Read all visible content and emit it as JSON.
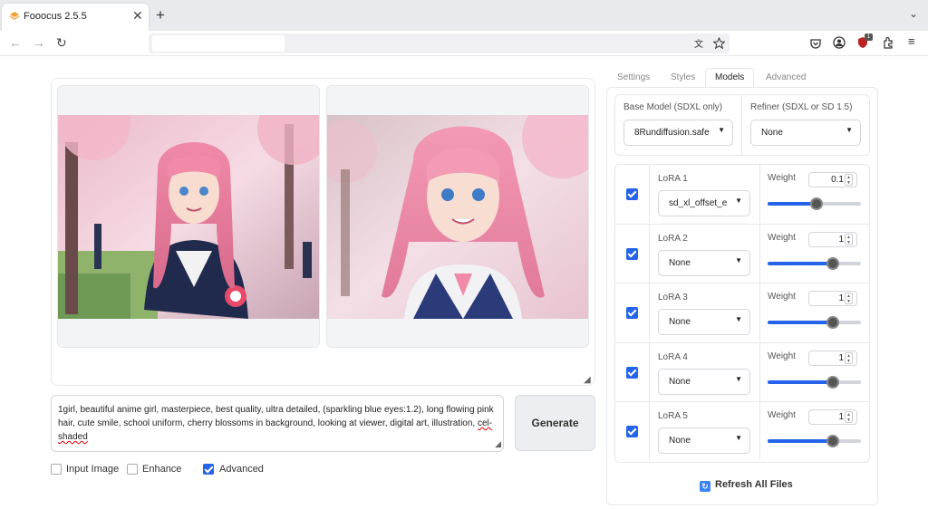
{
  "browser": {
    "tab_title": "Fooocus 2.5.5",
    "tab_close": "✕",
    "new_tab": "+",
    "tab_menu": "⌄",
    "extension_badge": "1",
    "colors": {
      "tab_strip": "#e8eaed",
      "url_bg": "#f0f0f4"
    }
  },
  "gallery": {
    "images": [
      {
        "alt": "Pink-haired anime girl in school uniform under cherry blossoms"
      },
      {
        "alt": "Pink-haired anime girl with twin tails smiling under cherry blossoms"
      }
    ]
  },
  "prompt": {
    "text_main": "1girl, beautiful anime girl, masterpiece, best quality, ultra detailed, (sparkling blue eyes:1.2), long flowing pink hair, cute smile, school uniform, cherry blossoms in background, looking at viewer, digital art, illustration, ",
    "text_marked": "cel-shaded"
  },
  "generate_label": "Generate",
  "options": {
    "input_image": {
      "label": "Input Image",
      "checked": false
    },
    "enhance": {
      "label": "Enhance",
      "checked": false
    },
    "advanced": {
      "label": "Advanced",
      "checked": true
    }
  },
  "panel_tabs": [
    "Settings",
    "Styles",
    "Models",
    "Advanced"
  ],
  "active_tab": "Models",
  "models": {
    "base_label": "Base Model (SDXL only)",
    "base_value": "8Rundiffusion.safe",
    "refiner_label": "Refiner (SDXL or SD 1.5)",
    "refiner_value": "None"
  },
  "loras": [
    {
      "label": "LoRA 1",
      "value": "sd_xl_offset_e",
      "weight_label": "Weight",
      "weight": "0.1",
      "slider_fraction": 0.52,
      "enabled": true
    },
    {
      "label": "LoRA 2",
      "value": "None",
      "weight_label": "Weight",
      "weight": "1",
      "slider_fraction": 0.7,
      "enabled": true
    },
    {
      "label": "LoRA 3",
      "value": "None",
      "weight_label": "Weight",
      "weight": "1",
      "slider_fraction": 0.7,
      "enabled": true
    },
    {
      "label": "LoRA 4",
      "value": "None",
      "weight_label": "Weight",
      "weight": "1",
      "slider_fraction": 0.7,
      "enabled": true
    },
    {
      "label": "LoRA 5",
      "value": "None",
      "weight_label": "Weight",
      "weight": "1",
      "slider_fraction": 0.7,
      "enabled": true
    }
  ],
  "refresh_label": "Refresh All Files",
  "accent_color": "#2563eb"
}
